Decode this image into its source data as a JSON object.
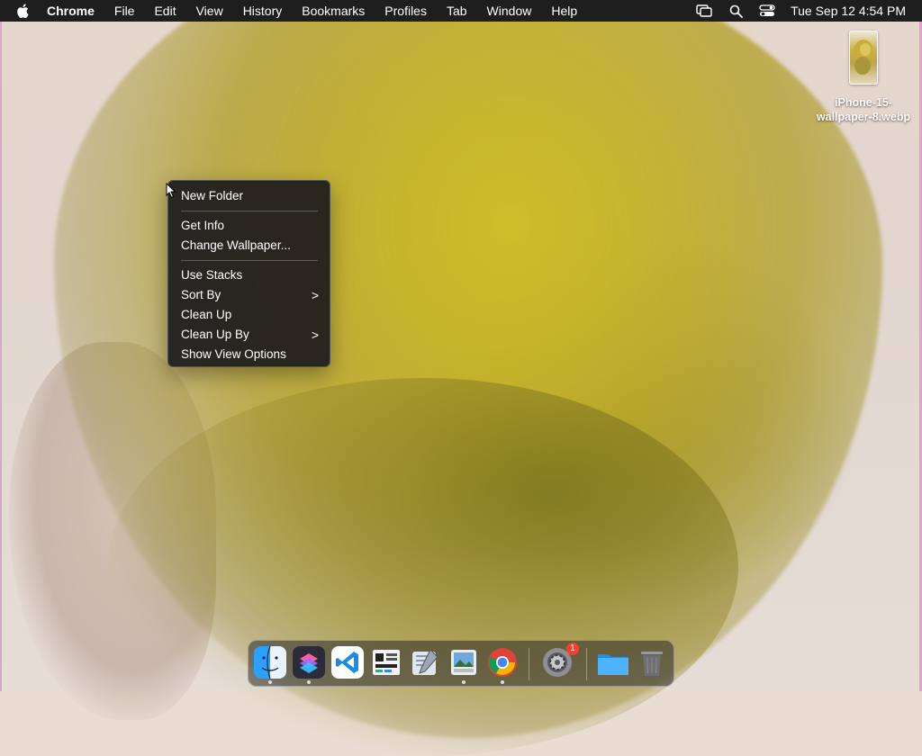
{
  "menubar": {
    "app_name": "Chrome",
    "menus": [
      "File",
      "Edit",
      "View",
      "History",
      "Bookmarks",
      "Profiles",
      "Tab",
      "Window",
      "Help"
    ],
    "clock": "Tue Sep 12  4:54 PM"
  },
  "context_menu": {
    "items": [
      {
        "label": "New Folder"
      },
      {
        "label": "Get Info"
      },
      {
        "label": "Change Wallpaper..."
      },
      {
        "label": "Use Stacks"
      },
      {
        "label": "Sort By",
        "submenu_arrow": ">"
      },
      {
        "label": "Clean Up"
      },
      {
        "label": "Clean Up By",
        "submenu_arrow": ">"
      },
      {
        "label": "Show View Options"
      }
    ]
  },
  "desktop": {
    "file_label": "iPhone-15-wallpaper-8.webp"
  },
  "dock": {
    "apps": [
      {
        "name": "finder-icon"
      },
      {
        "name": "shortcuts-icon"
      },
      {
        "name": "vscode-icon"
      },
      {
        "name": "activity-board-icon"
      },
      {
        "name": "script-editor-icon"
      },
      {
        "name": "preview-icon"
      },
      {
        "name": "chrome-icon"
      },
      {
        "name": "system-settings-icon",
        "badge": "1"
      },
      {
        "name": "downloads-folder-icon"
      },
      {
        "name": "trash-icon"
      }
    ]
  },
  "colors": {
    "menubar_bg": "#1e1e1e",
    "menu_bg": "#1c1c1c",
    "badge": "#ff3b30"
  }
}
